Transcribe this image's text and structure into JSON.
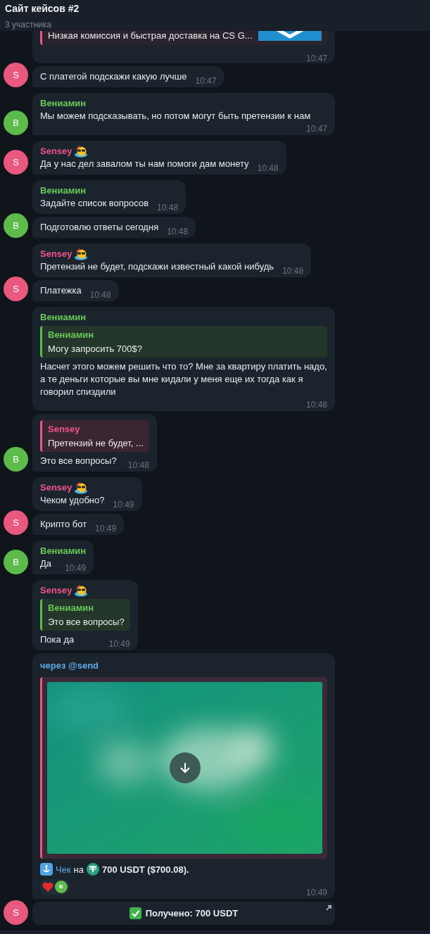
{
  "header": {
    "title": "Сайт кейсов #2",
    "subtitle": "3 участника"
  },
  "groups": [
    {
      "letter": "S",
      "color": "#e8587f",
      "messages": [
        {
          "kind": "preview",
          "preview_text": "Низкая комиссия и быстрая доставка на CS G...",
          "time": "10:47"
        },
        {
          "kind": "text",
          "text": "С платегой подскажи какую лучше",
          "time": "10:47"
        }
      ]
    },
    {
      "letter": "В",
      "color": "#5cbb4b",
      "messages": [
        {
          "kind": "text",
          "author": "Вениамин",
          "status_emoji": false,
          "text": "Мы можем подсказывать, но потом могут быть претензии к нам",
          "time": "10:47"
        }
      ]
    },
    {
      "letter": "S",
      "color": "#e8587f",
      "messages": [
        {
          "kind": "text",
          "author": "Sensey",
          "status_emoji": true,
          "text": "Да у нас дел завалом ты нам помоги дам монету",
          "time": "10:48"
        }
      ]
    },
    {
      "letter": "В",
      "color": "#5cbb4b",
      "messages": [
        {
          "kind": "text",
          "author": "Вениамин",
          "status_emoji": false,
          "text": "Задайте список вопросов",
          "time": "10:48"
        },
        {
          "kind": "text",
          "text": "Подготовлю ответы сегодня",
          "time": "10:48"
        }
      ]
    },
    {
      "letter": "S",
      "color": "#e8587f",
      "messages": [
        {
          "kind": "text",
          "author": "Sensey",
          "status_emoji": true,
          "text": "Претензий не будет, подскажи известный какой нибудь",
          "time": "10:48"
        },
        {
          "kind": "text",
          "text": "Платежка",
          "time": "10:48"
        }
      ]
    },
    {
      "letter": "В",
      "color": "#5cbb4b",
      "messages": [
        {
          "kind": "text",
          "author": "Вениамин",
          "status_emoji": false,
          "reply": {
            "author": "Вениамин",
            "text": "Могу запросить 700$?",
            "color": "#5cbb4b"
          },
          "text": "Насчет этого можем решить что то? Мне за квартиру платить надо, а те деньги которые вы мне кидали у меня еще их тогда как я говорил спиздили",
          "time": "10:48"
        },
        {
          "kind": "text",
          "reply": {
            "author": "Sensey",
            "text": "Претензий не будет, ...",
            "color": "#e8587f"
          },
          "text": "Это все вопросы?",
          "time": "10:48"
        }
      ]
    },
    {
      "letter": "S",
      "color": "#e8587f",
      "messages": [
        {
          "kind": "text",
          "author": "Sensey",
          "status_emoji": true,
          "text": "Чеком удобно?",
          "time": "10:49"
        },
        {
          "kind": "text",
          "text": "Крипто бот",
          "time": "10:49"
        }
      ]
    },
    {
      "letter": "В",
      "color": "#5cbb4b",
      "messages": [
        {
          "kind": "text",
          "author": "Вениамин",
          "status_emoji": false,
          "text": "Да",
          "time": "10:49"
        }
      ]
    },
    {
      "letter": "S",
      "color": "#e8587f",
      "messages": [
        {
          "kind": "text",
          "author": "Sensey",
          "status_emoji": true,
          "reply": {
            "author": "Вениамин",
            "text": "Это все вопросы?",
            "color": "#5cbb4b"
          },
          "text": "Пока да",
          "time": "10:49"
        },
        {
          "kind": "cheque",
          "via": "через @send",
          "link": "Чек",
          "middle": "на",
          "amount": "700 USDT ($700.08).",
          "reactions": [
            {
              "user": "В"
            }
          ],
          "time": "10:49",
          "button": "Получено: 700 USDT"
        }
      ]
    }
  ]
}
